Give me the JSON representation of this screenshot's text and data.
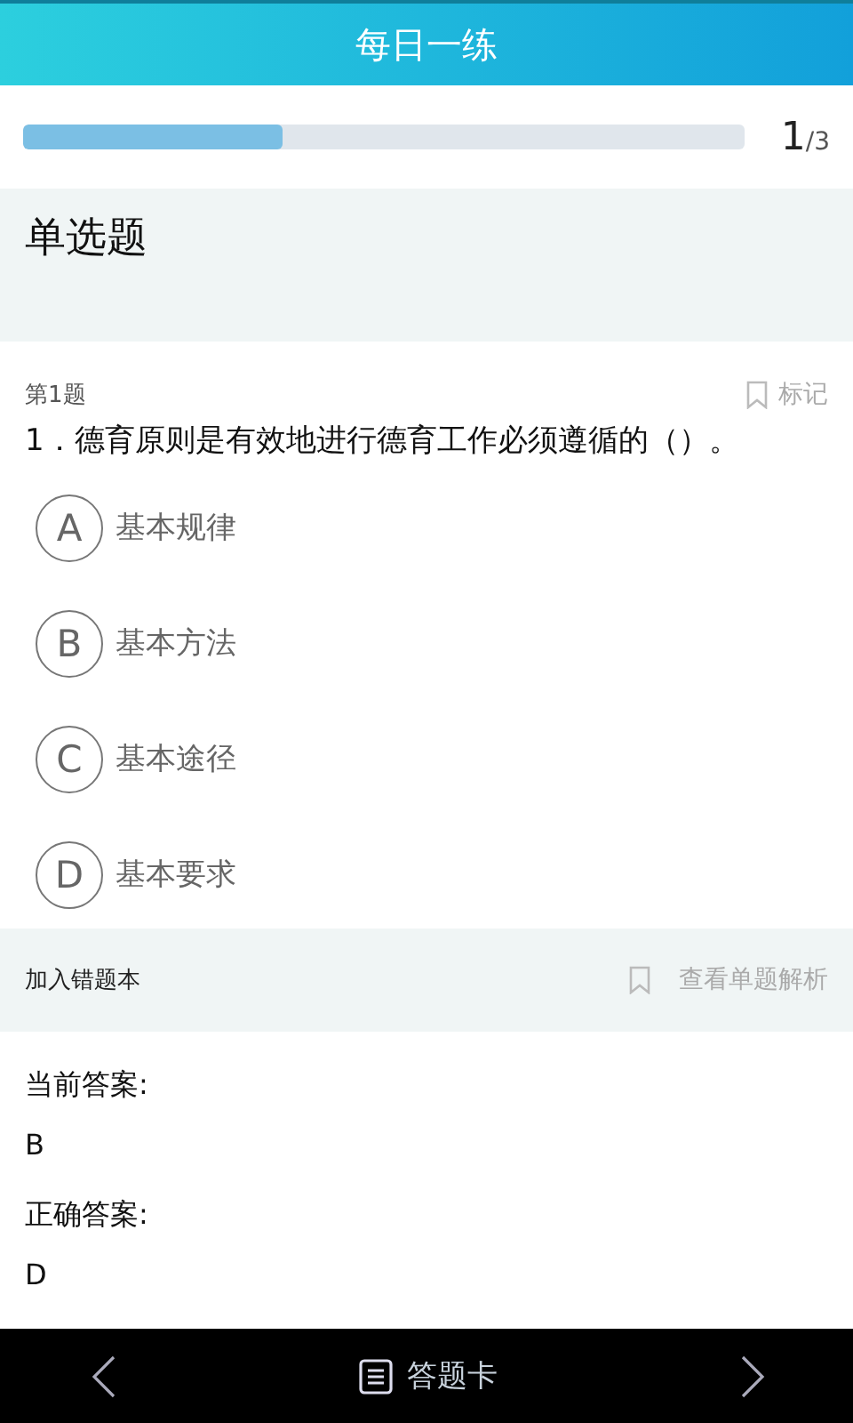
{
  "header": {
    "title": "每日一练"
  },
  "progress": {
    "level": 0.36,
    "current": "1",
    "total": "/3"
  },
  "section": {
    "title": "单选题"
  },
  "question": {
    "number": "第1题",
    "mark_label": "标记",
    "text": "1．德育原则是有效地进行德育工作必须遵循的（）。",
    "options": [
      {
        "letter": "A",
        "text": "基本规律"
      },
      {
        "letter": "B",
        "text": "基本方法"
      },
      {
        "letter": "C",
        "text": "基本途径"
      },
      {
        "letter": "D",
        "text": "基本要求"
      }
    ]
  },
  "actions": {
    "add_wrong": "加入错题本",
    "view_analysis": "查看单题解析"
  },
  "answers": [
    {
      "label": "当前答案:",
      "value": "B"
    },
    {
      "label": "正确答案:",
      "value": "D"
    }
  ],
  "bottom_bar": {
    "card_label": "答题卡"
  }
}
